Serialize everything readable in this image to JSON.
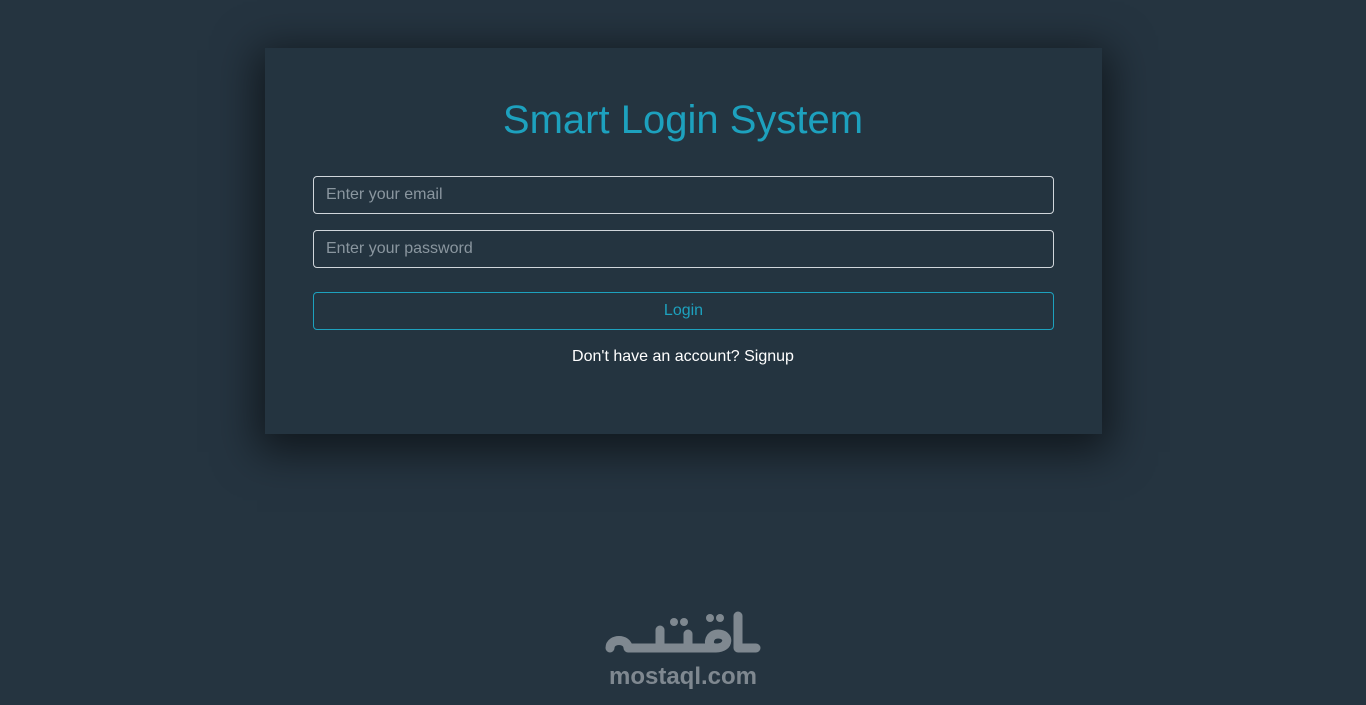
{
  "login_card": {
    "title": "Smart Login System",
    "email_placeholder": "Enter your email",
    "password_placeholder": "Enter your password",
    "login_label": "Login",
    "signup_prompt": "Don't have an account?",
    "signup_link": "Signup"
  },
  "watermark": {
    "text": "mostaql.com"
  },
  "colors": {
    "background": "#253440",
    "accent": "#1da1be",
    "text": "#ffffff"
  }
}
